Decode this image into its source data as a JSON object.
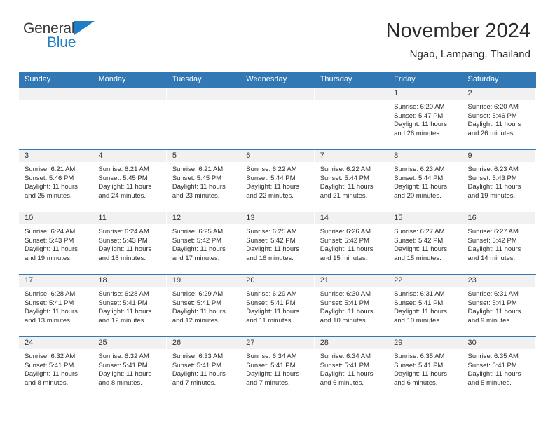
{
  "brand": {
    "name_part1": "General",
    "name_part2": "Blue",
    "triangle_color": "#1f7ec4",
    "text_color": "#3a3a3a"
  },
  "header": {
    "title": "November 2024",
    "location": "Ngao, Lampang, Thailand"
  },
  "theme": {
    "header_blue": "#3178b5",
    "daynum_band": "#f1f1f1",
    "text": "#2c2c2c"
  },
  "weekdays": [
    "Sunday",
    "Monday",
    "Tuesday",
    "Wednesday",
    "Thursday",
    "Friday",
    "Saturday"
  ],
  "weeks": [
    [
      {
        "day": "",
        "sunrise": "",
        "sunset": "",
        "daylight1": "",
        "daylight2": "",
        "empty": true
      },
      {
        "day": "",
        "sunrise": "",
        "sunset": "",
        "daylight1": "",
        "daylight2": "",
        "empty": true
      },
      {
        "day": "",
        "sunrise": "",
        "sunset": "",
        "daylight1": "",
        "daylight2": "",
        "empty": true
      },
      {
        "day": "",
        "sunrise": "",
        "sunset": "",
        "daylight1": "",
        "daylight2": "",
        "empty": true
      },
      {
        "day": "",
        "sunrise": "",
        "sunset": "",
        "daylight1": "",
        "daylight2": "",
        "empty": true
      },
      {
        "day": "1",
        "sunrise": "Sunrise: 6:20 AM",
        "sunset": "Sunset: 5:47 PM",
        "daylight1": "Daylight: 11 hours",
        "daylight2": "and 26 minutes."
      },
      {
        "day": "2",
        "sunrise": "Sunrise: 6:20 AM",
        "sunset": "Sunset: 5:46 PM",
        "daylight1": "Daylight: 11 hours",
        "daylight2": "and 26 minutes."
      }
    ],
    [
      {
        "day": "3",
        "sunrise": "Sunrise: 6:21 AM",
        "sunset": "Sunset: 5:46 PM",
        "daylight1": "Daylight: 11 hours",
        "daylight2": "and 25 minutes."
      },
      {
        "day": "4",
        "sunrise": "Sunrise: 6:21 AM",
        "sunset": "Sunset: 5:45 PM",
        "daylight1": "Daylight: 11 hours",
        "daylight2": "and 24 minutes."
      },
      {
        "day": "5",
        "sunrise": "Sunrise: 6:21 AM",
        "sunset": "Sunset: 5:45 PM",
        "daylight1": "Daylight: 11 hours",
        "daylight2": "and 23 minutes."
      },
      {
        "day": "6",
        "sunrise": "Sunrise: 6:22 AM",
        "sunset": "Sunset: 5:44 PM",
        "daylight1": "Daylight: 11 hours",
        "daylight2": "and 22 minutes."
      },
      {
        "day": "7",
        "sunrise": "Sunrise: 6:22 AM",
        "sunset": "Sunset: 5:44 PM",
        "daylight1": "Daylight: 11 hours",
        "daylight2": "and 21 minutes."
      },
      {
        "day": "8",
        "sunrise": "Sunrise: 6:23 AM",
        "sunset": "Sunset: 5:44 PM",
        "daylight1": "Daylight: 11 hours",
        "daylight2": "and 20 minutes."
      },
      {
        "day": "9",
        "sunrise": "Sunrise: 6:23 AM",
        "sunset": "Sunset: 5:43 PM",
        "daylight1": "Daylight: 11 hours",
        "daylight2": "and 19 minutes."
      }
    ],
    [
      {
        "day": "10",
        "sunrise": "Sunrise: 6:24 AM",
        "sunset": "Sunset: 5:43 PM",
        "daylight1": "Daylight: 11 hours",
        "daylight2": "and 19 minutes."
      },
      {
        "day": "11",
        "sunrise": "Sunrise: 6:24 AM",
        "sunset": "Sunset: 5:43 PM",
        "daylight1": "Daylight: 11 hours",
        "daylight2": "and 18 minutes."
      },
      {
        "day": "12",
        "sunrise": "Sunrise: 6:25 AM",
        "sunset": "Sunset: 5:42 PM",
        "daylight1": "Daylight: 11 hours",
        "daylight2": "and 17 minutes."
      },
      {
        "day": "13",
        "sunrise": "Sunrise: 6:25 AM",
        "sunset": "Sunset: 5:42 PM",
        "daylight1": "Daylight: 11 hours",
        "daylight2": "and 16 minutes."
      },
      {
        "day": "14",
        "sunrise": "Sunrise: 6:26 AM",
        "sunset": "Sunset: 5:42 PM",
        "daylight1": "Daylight: 11 hours",
        "daylight2": "and 15 minutes."
      },
      {
        "day": "15",
        "sunrise": "Sunrise: 6:27 AM",
        "sunset": "Sunset: 5:42 PM",
        "daylight1": "Daylight: 11 hours",
        "daylight2": "and 15 minutes."
      },
      {
        "day": "16",
        "sunrise": "Sunrise: 6:27 AM",
        "sunset": "Sunset: 5:42 PM",
        "daylight1": "Daylight: 11 hours",
        "daylight2": "and 14 minutes."
      }
    ],
    [
      {
        "day": "17",
        "sunrise": "Sunrise: 6:28 AM",
        "sunset": "Sunset: 5:41 PM",
        "daylight1": "Daylight: 11 hours",
        "daylight2": "and 13 minutes."
      },
      {
        "day": "18",
        "sunrise": "Sunrise: 6:28 AM",
        "sunset": "Sunset: 5:41 PM",
        "daylight1": "Daylight: 11 hours",
        "daylight2": "and 12 minutes."
      },
      {
        "day": "19",
        "sunrise": "Sunrise: 6:29 AM",
        "sunset": "Sunset: 5:41 PM",
        "daylight1": "Daylight: 11 hours",
        "daylight2": "and 12 minutes."
      },
      {
        "day": "20",
        "sunrise": "Sunrise: 6:29 AM",
        "sunset": "Sunset: 5:41 PM",
        "daylight1": "Daylight: 11 hours",
        "daylight2": "and 11 minutes."
      },
      {
        "day": "21",
        "sunrise": "Sunrise: 6:30 AM",
        "sunset": "Sunset: 5:41 PM",
        "daylight1": "Daylight: 11 hours",
        "daylight2": "and 10 minutes."
      },
      {
        "day": "22",
        "sunrise": "Sunrise: 6:31 AM",
        "sunset": "Sunset: 5:41 PM",
        "daylight1": "Daylight: 11 hours",
        "daylight2": "and 10 minutes."
      },
      {
        "day": "23",
        "sunrise": "Sunrise: 6:31 AM",
        "sunset": "Sunset: 5:41 PM",
        "daylight1": "Daylight: 11 hours",
        "daylight2": "and 9 minutes."
      }
    ],
    [
      {
        "day": "24",
        "sunrise": "Sunrise: 6:32 AM",
        "sunset": "Sunset: 5:41 PM",
        "daylight1": "Daylight: 11 hours",
        "daylight2": "and 8 minutes."
      },
      {
        "day": "25",
        "sunrise": "Sunrise: 6:32 AM",
        "sunset": "Sunset: 5:41 PM",
        "daylight1": "Daylight: 11 hours",
        "daylight2": "and 8 minutes."
      },
      {
        "day": "26",
        "sunrise": "Sunrise: 6:33 AM",
        "sunset": "Sunset: 5:41 PM",
        "daylight1": "Daylight: 11 hours",
        "daylight2": "and 7 minutes."
      },
      {
        "day": "27",
        "sunrise": "Sunrise: 6:34 AM",
        "sunset": "Sunset: 5:41 PM",
        "daylight1": "Daylight: 11 hours",
        "daylight2": "and 7 minutes."
      },
      {
        "day": "28",
        "sunrise": "Sunrise: 6:34 AM",
        "sunset": "Sunset: 5:41 PM",
        "daylight1": "Daylight: 11 hours",
        "daylight2": "and 6 minutes."
      },
      {
        "day": "29",
        "sunrise": "Sunrise: 6:35 AM",
        "sunset": "Sunset: 5:41 PM",
        "daylight1": "Daylight: 11 hours",
        "daylight2": "and 6 minutes."
      },
      {
        "day": "30",
        "sunrise": "Sunrise: 6:35 AM",
        "sunset": "Sunset: 5:41 PM",
        "daylight1": "Daylight: 11 hours",
        "daylight2": "and 5 minutes."
      }
    ]
  ]
}
